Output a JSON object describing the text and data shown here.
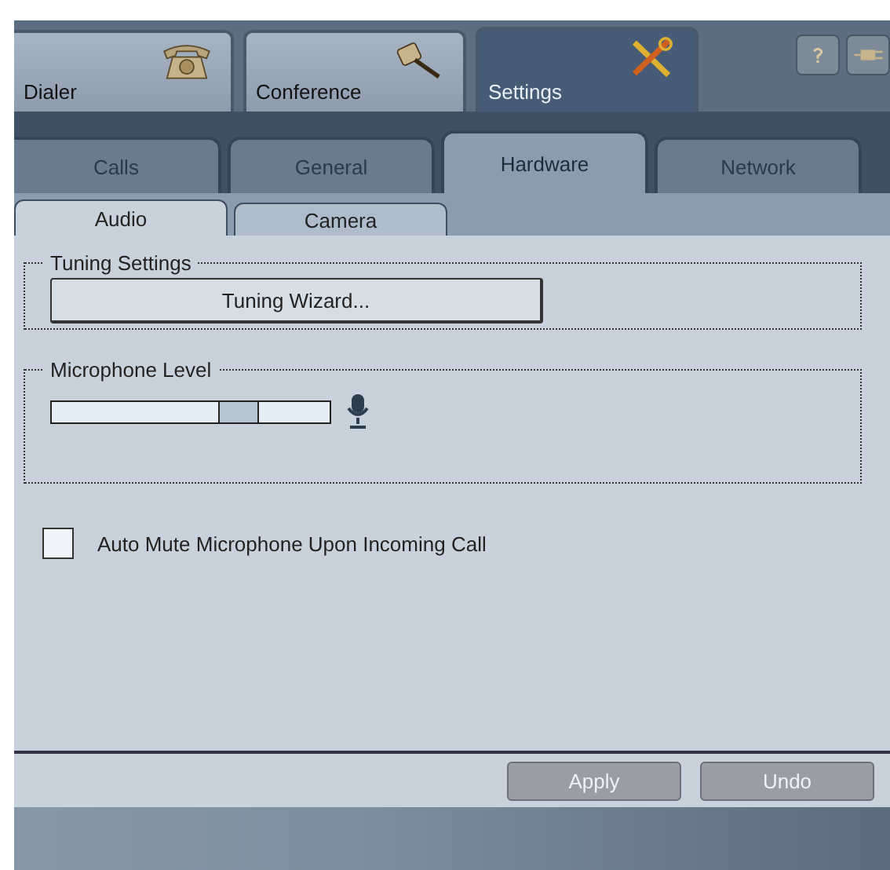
{
  "main_tabs": [
    {
      "label": "Dialer",
      "selected": false
    },
    {
      "label": "Conference",
      "selected": false
    },
    {
      "label": "Settings",
      "selected": true
    }
  ],
  "sub_tabs": [
    {
      "label": "Calls",
      "selected": false
    },
    {
      "label": "General",
      "selected": false
    },
    {
      "label": "Hardware",
      "selected": true
    },
    {
      "label": "Network",
      "selected": false
    }
  ],
  "inner_tabs": [
    {
      "label": "Audio",
      "selected": true
    },
    {
      "label": "Camera",
      "selected": false
    }
  ],
  "tuning_group": {
    "title": "Tuning Settings",
    "button": "Tuning Wizard..."
  },
  "mic_group": {
    "title": "Microphone Level",
    "level": 0.7
  },
  "auto_mute": {
    "label": "Auto Mute Microphone Upon Incoming Call",
    "checked": false
  },
  "buttons": [
    {
      "label": "Apply",
      "disabled": true
    },
    {
      "label": "Undo",
      "disabled": true
    }
  ]
}
